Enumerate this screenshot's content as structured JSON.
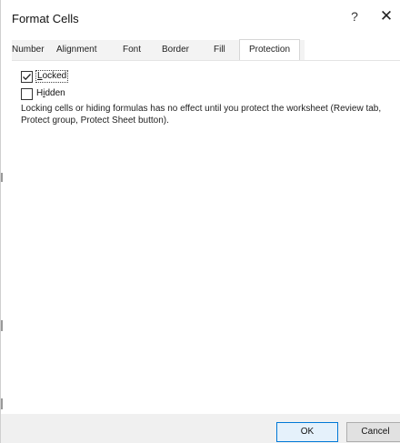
{
  "dialog": {
    "title": "Format Cells",
    "help_label": "?",
    "close_label": "✕"
  },
  "tabs": [
    {
      "label": "Number",
      "active": false
    },
    {
      "label": "Alignment",
      "active": false
    },
    {
      "label": "Font",
      "active": false
    },
    {
      "label": "Border",
      "active": false
    },
    {
      "label": "Fill",
      "active": false
    },
    {
      "label": "Protection",
      "active": true
    }
  ],
  "protection": {
    "locked": {
      "label_pre": "",
      "label_ul": "L",
      "label_post": "ocked",
      "checked": true
    },
    "hidden": {
      "label_pre": "H",
      "label_ul": "i",
      "label_post": "dden",
      "checked": false
    },
    "description": "Locking cells or hiding formulas has no effect until you protect the worksheet (Review tab, Protect group, Protect Sheet button)."
  },
  "footer": {
    "ok_label": "OK",
    "cancel_label": "Cancel"
  }
}
